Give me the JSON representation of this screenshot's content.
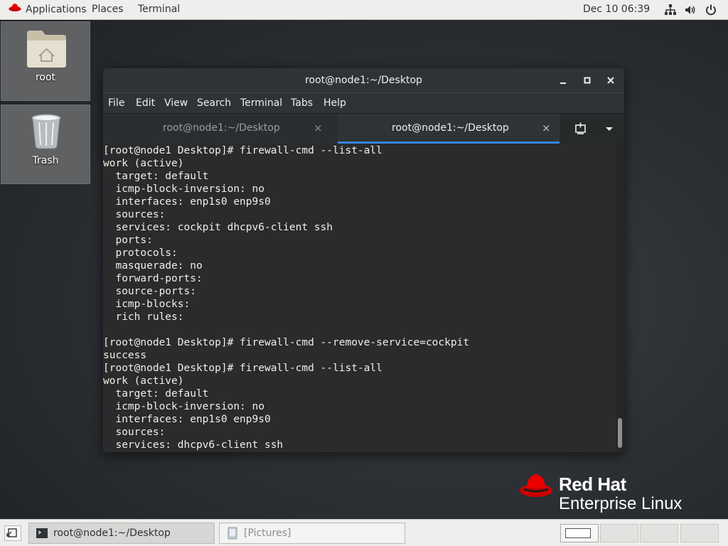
{
  "top_bar": {
    "applications_label": "Applications",
    "places_label": "Places",
    "terminal_label": "Terminal",
    "clock": "Dec 10  06:39",
    "tray_icons": [
      "network-icon",
      "volume-icon",
      "power-icon"
    ]
  },
  "desktop": {
    "icons": [
      {
        "label": "root",
        "icon": "home-folder-icon"
      },
      {
        "label": "Trash",
        "icon": "trash-icon"
      }
    ]
  },
  "window": {
    "title": "root@node1:~/Desktop",
    "buttons": [
      "minimize-icon",
      "maximize-icon",
      "close-icon"
    ],
    "menu": [
      "File",
      "Edit",
      "View",
      "Search",
      "Terminal",
      "Tabs",
      "Help"
    ],
    "tabs": [
      {
        "label": "root@node1:~/Desktop",
        "active": false
      },
      {
        "label": "root@node1:~/Desktop",
        "active": true
      }
    ],
    "tab_close_glyph": "×"
  },
  "terminal": {
    "lines": [
      "[root@node1 Desktop]# firewall-cmd --list-all",
      "work (active)",
      "  target: default",
      "  icmp-block-inversion: no",
      "  interfaces: enp1s0 enp9s0",
      "  sources: ",
      "  services: cockpit dhcpv6-client ssh",
      "  ports: ",
      "  protocols: ",
      "  masquerade: no",
      "  forward-ports: ",
      "  source-ports: ",
      "  icmp-blocks: ",
      "  rich rules: ",
      "",
      "[root@node1 Desktop]# firewall-cmd --remove-service=cockpit",
      "success",
      "[root@node1 Desktop]# firewall-cmd --list-all",
      "work (active)",
      "  target: default",
      "  icmp-block-inversion: no",
      "  interfaces: enp1s0 enp9s0",
      "  sources: ",
      "  services: dhcpv6-client ssh"
    ]
  },
  "branding": {
    "name": "Red Hat",
    "product": "Enterprise Linux",
    "accent": "#ee0000"
  },
  "taskbar": {
    "tasks": [
      {
        "label": "root@node1:~/Desktop",
        "icon": "terminal-icon",
        "active": true
      },
      {
        "label": "[Pictures]",
        "icon": "file-manager-icon",
        "active": false
      }
    ],
    "workspaces_count": 4,
    "current_workspace": 1
  }
}
